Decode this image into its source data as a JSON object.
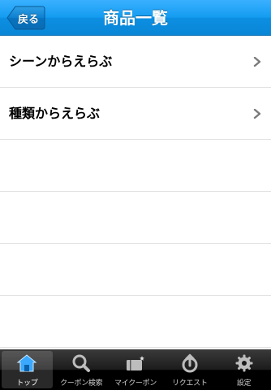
{
  "navbar": {
    "back_label": "戻る",
    "title": "商品一覧"
  },
  "list": {
    "items": [
      {
        "label": "シーンからえらぶ"
      },
      {
        "label": "種類からえらぶ"
      }
    ]
  },
  "tabbar": {
    "selected": "トップ",
    "tabs": [
      {
        "label": "トップ",
        "icon": "home-icon"
      },
      {
        "label": "クーポン検索",
        "icon": "search-icon"
      },
      {
        "label": "マイクーポン",
        "icon": "coupon-icon"
      },
      {
        "label": "リクエスト",
        "icon": "request-icon"
      },
      {
        "label": "設定",
        "icon": "gear-icon"
      }
    ]
  },
  "colors": {
    "navbar_blue": "#139cf0",
    "tabbar_black": "#000000",
    "home_icon_blue": "#3aa8ff",
    "separator": "#e0e0e0"
  }
}
